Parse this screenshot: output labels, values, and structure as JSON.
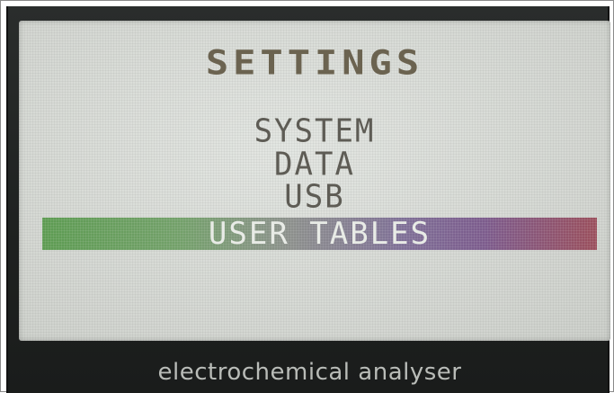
{
  "screen": {
    "title": "SETTINGS",
    "menu_items": [
      {
        "label": "SYSTEM",
        "selected": false
      },
      {
        "label": "DATA",
        "selected": false
      },
      {
        "label": "USB",
        "selected": false
      },
      {
        "label": "USER TABLES",
        "selected": true
      }
    ]
  },
  "device": {
    "brand_text": "electrochemical analyser"
  },
  "colors": {
    "lcd_background": "#dcdfda",
    "lcd_text": "#5e5c55",
    "selection_start": "#5d9b52",
    "selection_end": "#9a4f5c"
  }
}
